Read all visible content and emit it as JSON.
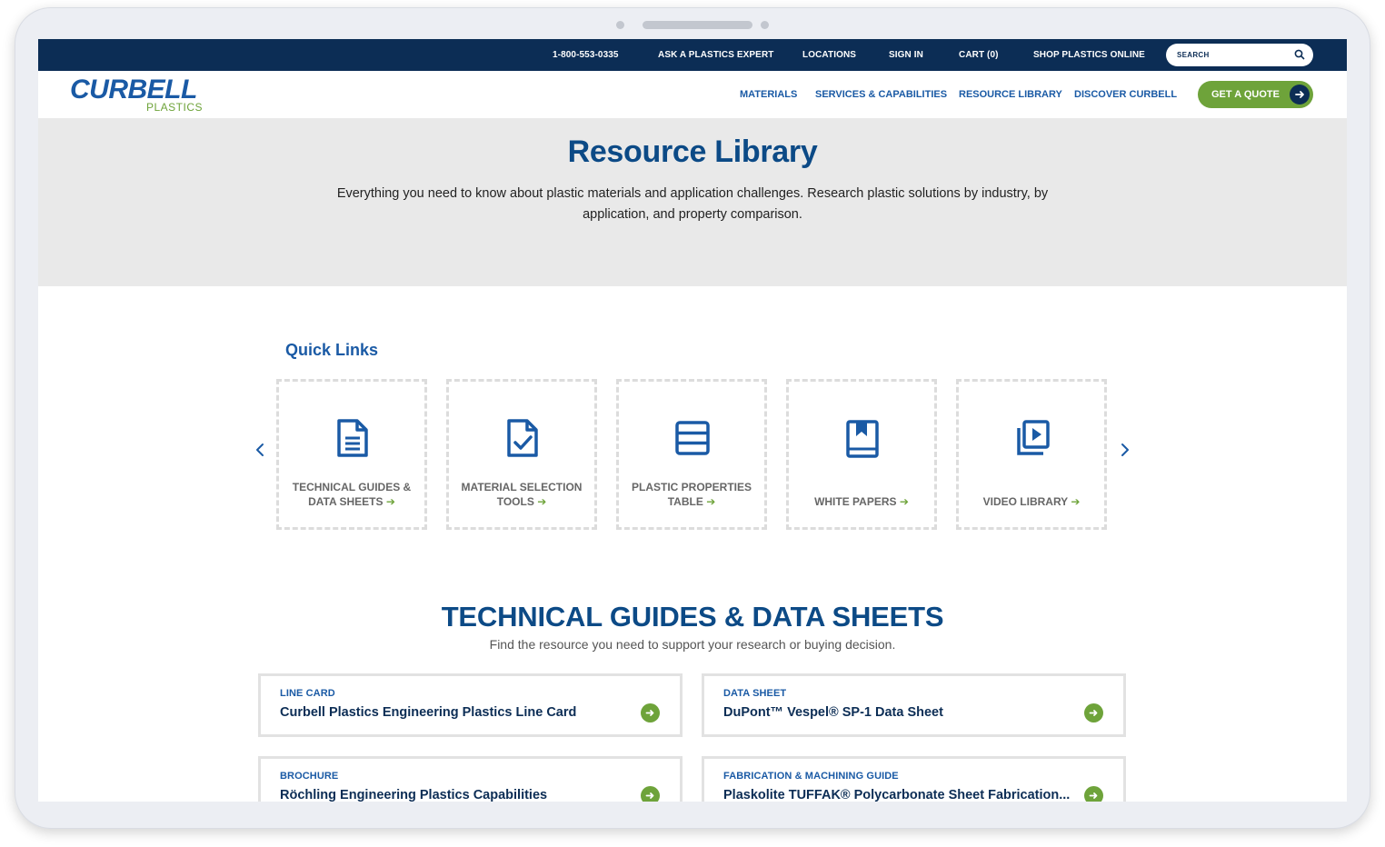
{
  "topbar": {
    "phone": "1-800-553-0335",
    "ask_expert": "ASK A PLASTICS EXPERT",
    "locations": "LOCATIONS",
    "sign_in": "SIGN IN",
    "cart": "CART (0)",
    "shop": "SHOP PLASTICS ONLINE",
    "search_placeholder": "SEARCH"
  },
  "logo": {
    "word": "CURBELL",
    "sub": "PLASTICS"
  },
  "nav": {
    "materials": "MATERIALS",
    "services": "SERVICES & CAPABILITIES",
    "resource_library": "RESOURCE LIBRARY",
    "discover": "DISCOVER CURBELL",
    "quote": "GET A QUOTE"
  },
  "hero": {
    "title": "Resource Library",
    "description": "Everything you need to know about plastic materials and application challenges. Research plastic solutions by industry, by application, and property comparison."
  },
  "quick_links": {
    "title": "Quick Links",
    "items": [
      {
        "line1": "TECHNICAL GUIDES &",
        "line2": "DATA SHEETS",
        "icon": "document-icon"
      },
      {
        "line1": "MATERIAL SELECTION",
        "line2": "TOOLS",
        "icon": "document-check-icon"
      },
      {
        "line1": "PLASTIC PROPERTIES",
        "line2": "TABLE",
        "icon": "table-icon"
      },
      {
        "line1": "",
        "line2": "WHITE PAPERS",
        "icon": "bookmark-book-icon"
      },
      {
        "line1": "",
        "line2": "VIDEO LIBRARY",
        "icon": "video-library-icon"
      }
    ]
  },
  "section": {
    "title": "TECHNICAL GUIDES & DATA SHEETS",
    "subtitle": "Find the resource you need to support your research or buying decision.",
    "cards": [
      {
        "type": "LINE CARD",
        "title": "Curbell Plastics Engineering Plastics Line Card"
      },
      {
        "type": "DATA SHEET",
        "title": "DuPont™ Vespel® SP-1 Data Sheet"
      },
      {
        "type": "BROCHURE",
        "title": "Röchling Engineering Plastics Capabilities"
      },
      {
        "type": "FABRICATION & MACHINING GUIDE",
        "title": "Plaskolite TUFFAK® Polycarbonate Sheet Fabrication..."
      }
    ]
  },
  "colors": {
    "navy": "#0c2d55",
    "blue": "#1a5aa5",
    "green": "#6ea33a",
    "hero_bg": "#e9e9e9"
  }
}
